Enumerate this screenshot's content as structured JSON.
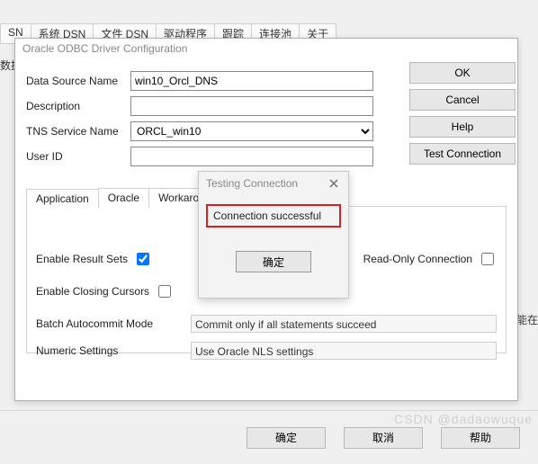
{
  "bg": {
    "tabs": [
      "SN",
      "系统 DSN",
      "文件 DSN",
      "驱动程序",
      "跟踪",
      "连接池",
      "关于"
    ],
    "left_text": "数据",
    "right_text1": "能在",
    "help_btn": "帮助"
  },
  "window": {
    "title": "Oracle ODBC Driver Configuration"
  },
  "form": {
    "dsn_label": "Data Source Name",
    "dsn_value": "win10_Orcl_DNS",
    "desc_label": "Description",
    "desc_value": "",
    "tns_label": "TNS Service Name",
    "tns_value": "ORCL_win10",
    "uid_label": "User ID",
    "uid_value": ""
  },
  "buttons": {
    "ok": "OK",
    "cancel": "Cancel",
    "help": "Help",
    "test": "Test Connection"
  },
  "tabs": [
    "Application",
    "Oracle",
    "Workarounds"
  ],
  "options": {
    "enable_result_sets": "Enable Result Sets",
    "enable_closing_cursors": "Enable Closing Cursors",
    "read_only": "Read-Only Connection",
    "batch_label": "Batch Autocommit Mode",
    "batch_value": "Commit only if all statements succeed",
    "numeric_label": "Numeric Settings",
    "numeric_value": "Use Oracle NLS settings"
  },
  "popup": {
    "title": "Testing Connection",
    "message": "Connection successful",
    "ok": "确定"
  },
  "footer": {
    "ok": "确定",
    "cancel": "取消"
  },
  "watermark": "CSDN @dadaowuque"
}
